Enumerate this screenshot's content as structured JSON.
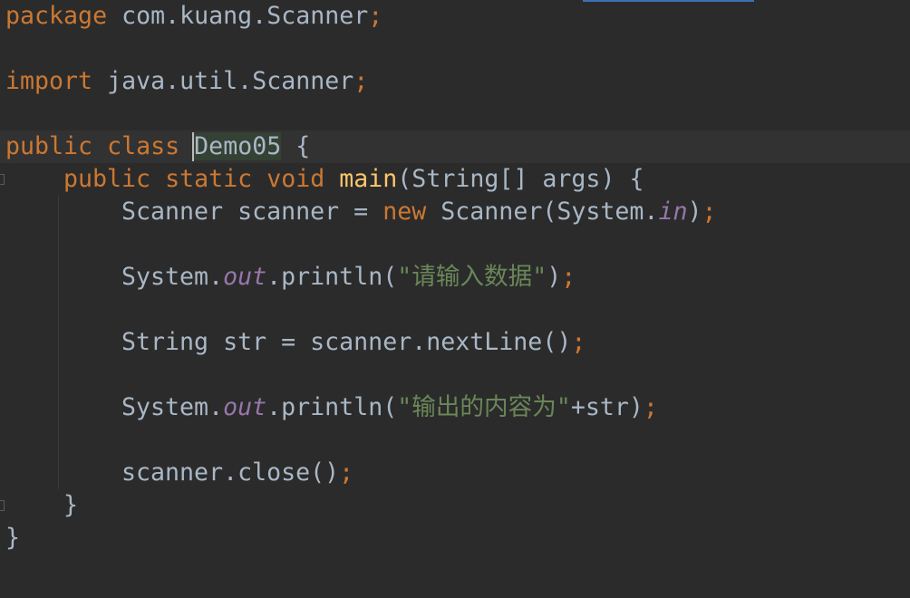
{
  "code": {
    "line1": {
      "kw": "package",
      "rest": " com.kuang.Scanner",
      "semi": ";"
    },
    "line2": {
      "kw": "import",
      "rest": " java.util.Scanner",
      "semi": ";"
    },
    "line3": {
      "kw1": "public",
      "sp1": " ",
      "kw2": "class",
      "sp2": " ",
      "name": "Demo05",
      "rest": " {"
    },
    "line4": {
      "kw1": "public",
      "sp1": " ",
      "kw2": "static",
      "sp2": " ",
      "kw3": "void",
      "sp3": " ",
      "fn": "main",
      "rest": "(String[] args) {"
    },
    "line5": {
      "a": "Scanner scanner = ",
      "kw": "new",
      "b": " Scanner(System.",
      "field": "in",
      "c": ")",
      "semi": ";"
    },
    "line6": {
      "a": "System.",
      "field": "out",
      "b": ".println(",
      "str": "\"请输入数据\"",
      "c": ")",
      "semi": ";"
    },
    "line7": {
      "a": "String str = scanner.nextLine()",
      "semi": ";"
    },
    "line8": {
      "a": "System.",
      "field": "out",
      "b": ".println(",
      "str": "\"输出的内容为\"",
      "c": "+str)",
      "semi": ";"
    },
    "line9": {
      "a": "scanner.close()",
      "semi": ";"
    },
    "line10": {
      "a": "}"
    },
    "line11": {
      "a": "}"
    }
  },
  "colors": {
    "background": "#2b2b2b",
    "keyword": "#cc7832",
    "function": "#ffc66d",
    "string": "#6a8759",
    "field": "#9876aa",
    "text": "#a9b7c6"
  }
}
